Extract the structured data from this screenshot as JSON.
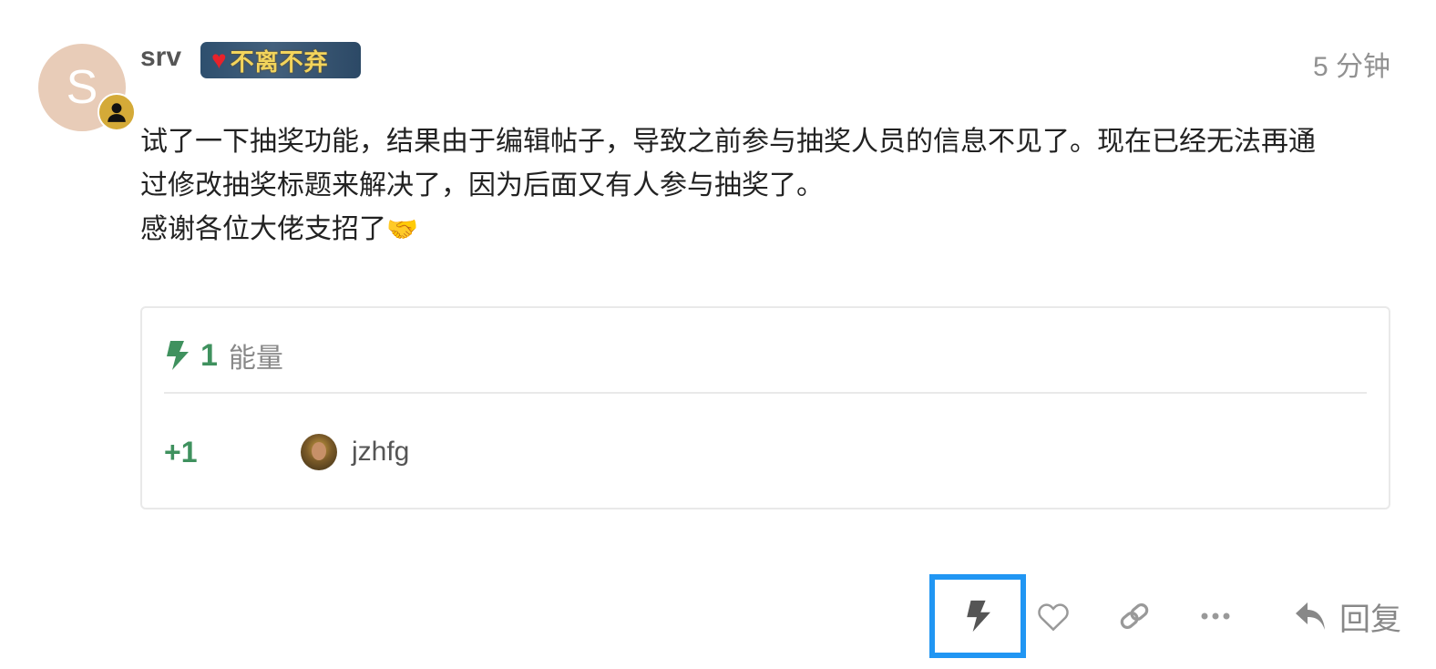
{
  "post": {
    "avatar_letter": "S",
    "username": "srv",
    "badge": {
      "heart": "♥",
      "text": "不离不弃"
    },
    "time": "5 分钟",
    "body_lines": [
      "试了一下抽奖功能，结果由于编辑帖子，导致之前参与抽奖人员的信息不见了。现在已经无法再通",
      "过修改抽奖标题来解决了，因为后面又有人参与抽奖了。",
      "感谢各位大佬支招了"
    ],
    "body_emoji": "🤝"
  },
  "energy": {
    "count": "1",
    "unit": "能量",
    "entries": [
      {
        "amount": "+1",
        "user": "jzhfg"
      }
    ]
  },
  "actions": {
    "reply_label": "回复",
    "icons": [
      "bolt-icon",
      "heart-icon",
      "link-icon",
      "more-icon",
      "reply-icon"
    ]
  },
  "colors": {
    "energy_green": "#3f915e",
    "highlight_blue": "#2196f3",
    "avatar_bg": "#e8ccb8",
    "flair_bg": "#d4aa38"
  }
}
